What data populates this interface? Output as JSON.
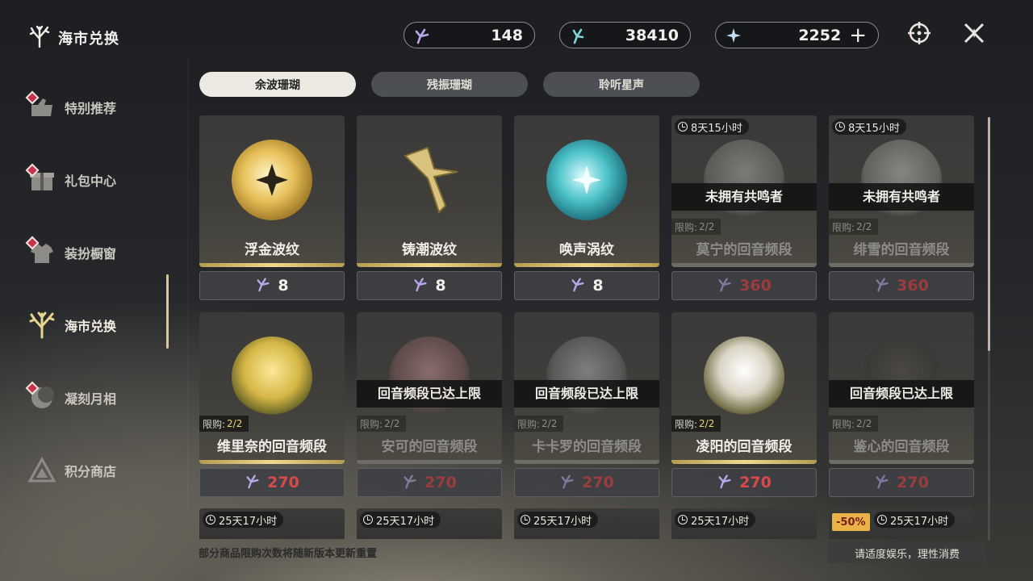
{
  "header": {
    "title": "海市兑换"
  },
  "sidebar": {
    "items": [
      {
        "label": "特别推荐",
        "icon": "special-recommend-icon",
        "badge": true
      },
      {
        "label": "礼包中心",
        "icon": "gift-icon",
        "badge": true
      },
      {
        "label": "装扮橱窗",
        "icon": "outfit-icon",
        "badge": true
      },
      {
        "label": "海市兑换",
        "icon": "coral-icon",
        "badge": false,
        "active": true
      },
      {
        "label": "凝刻月相",
        "icon": "moon-phase-icon",
        "badge": true
      },
      {
        "label": "积分商店",
        "icon": "points-shop-icon",
        "badge": false
      }
    ]
  },
  "currencies": [
    {
      "icon": "afterglow-coral-icon",
      "value": "148"
    },
    {
      "icon": "oscillated-coral-icon",
      "value": "38410"
    },
    {
      "icon": "astrite-icon",
      "value": "2252",
      "plus": "+"
    }
  ],
  "tabs": [
    {
      "label": "余波珊瑚",
      "active": true
    },
    {
      "label": "残振珊瑚",
      "active": false
    },
    {
      "label": "聆听星声",
      "active": false
    }
  ],
  "rows": [
    [
      {
        "name": "浮金波纹",
        "price": "8",
        "state": "normal",
        "art": "gold-orb"
      },
      {
        "name": "铸潮波纹",
        "price": "8",
        "state": "normal",
        "art": "blade"
      },
      {
        "name": "唤声涡纹",
        "price": "8",
        "state": "normal",
        "art": "teal-orb"
      },
      {
        "name": "莫宁的回音频段",
        "price": "360",
        "state": "dim",
        "timer": "8天15小时",
        "overlay": "未拥有共鸣者",
        "limit_label": "限购:",
        "limit": "2/2",
        "art": "portrait-silver"
      },
      {
        "name": "绯雪的回音频段",
        "price": "360",
        "state": "dim",
        "timer": "8天15小时",
        "overlay": "未拥有共鸣者",
        "limit_label": "限购:",
        "limit": "2/2",
        "art": "portrait-silver"
      }
    ],
    [
      {
        "name": "维里奈的回音频段",
        "price": "270",
        "state": "normal-red",
        "limit_label": "限购:",
        "limit": "2/2",
        "art": "portrait-gold"
      },
      {
        "name": "安可的回音频段",
        "price": "270",
        "state": "dim",
        "overlay": "回音频段已达上限",
        "limit_label": "限购:",
        "limit": "2/2",
        "art": "portrait-pink"
      },
      {
        "name": "卡卡罗的回音频段",
        "price": "270",
        "state": "dim",
        "overlay": "回音频段已达上限",
        "limit_label": "限购:",
        "limit": "2/2",
        "art": "portrait-grey"
      },
      {
        "name": "凌阳的回音频段",
        "price": "270",
        "state": "normal-red",
        "limit_label": "限购:",
        "limit": "2/2",
        "art": "portrait-white"
      },
      {
        "name": "鉴心的回音频段",
        "price": "270",
        "state": "dim",
        "overlay": "回音频段已达上限",
        "limit_label": "限购:",
        "limit": "2/2",
        "art": "portrait-dark"
      }
    ]
  ],
  "partial_row": [
    {
      "timer": "25天17小时"
    },
    {
      "timer": "25天17小时"
    },
    {
      "timer": "25天17小时"
    },
    {
      "timer": "25天17小时"
    },
    {
      "timer": "25天17小时",
      "discount": "-50%"
    }
  ],
  "footer": {
    "note": "部分商品限购次数将随新版本更新重置",
    "right": "请适度娱乐，理性消费"
  },
  "colors": {
    "accent_gold": "#ecd47c",
    "price_red": "#d84a4a",
    "badge_red": "#c8324a"
  }
}
